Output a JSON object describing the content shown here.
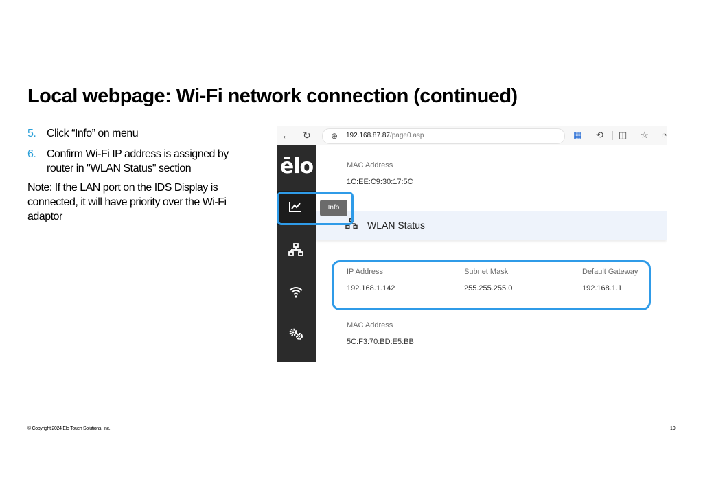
{
  "slide": {
    "title": "Local webpage: Wi-Fi network connection (continued)",
    "steps": [
      {
        "num": "5.",
        "text": "Click “Info” on menu"
      },
      {
        "num": "6.",
        "text": "Confirm Wi-Fi IP address is assigned by router in \"WLAN Status\" section"
      }
    ],
    "note": "Note: If the LAN port on the IDS Display is connected, it will have priority over the Wi-Fi adaptor",
    "copyright": "© Copyright 2024 Elo Touch Solutions, Inc.",
    "page_number": "19",
    "accent_color": "#2a9fd8"
  },
  "browser": {
    "url_host": "192.168.87.87",
    "url_path": "/page0.asp"
  },
  "app": {
    "logo": "ēlo",
    "tooltip": "Info",
    "sidebar_items": [
      "info-icon",
      "network-icon",
      "wifi-icon",
      "settings-icon"
    ],
    "top_mac_label": "MAC Address",
    "top_mac_value": "1C:EE:C9:30:17:5C",
    "wlan_title": "WLAN Status",
    "ip_label": "IP Address",
    "ip_value": "192.168.1.142",
    "subnet_label": "Subnet Mask",
    "subnet_value": "255.255.255.0",
    "gateway_label": "Default Gateway",
    "gateway_value": "192.168.1.1",
    "wlan_mac_label": "MAC Address",
    "wlan_mac_value": "5C:F3:70:BD:E5:BB",
    "highlight_color": "#2f9be8"
  }
}
